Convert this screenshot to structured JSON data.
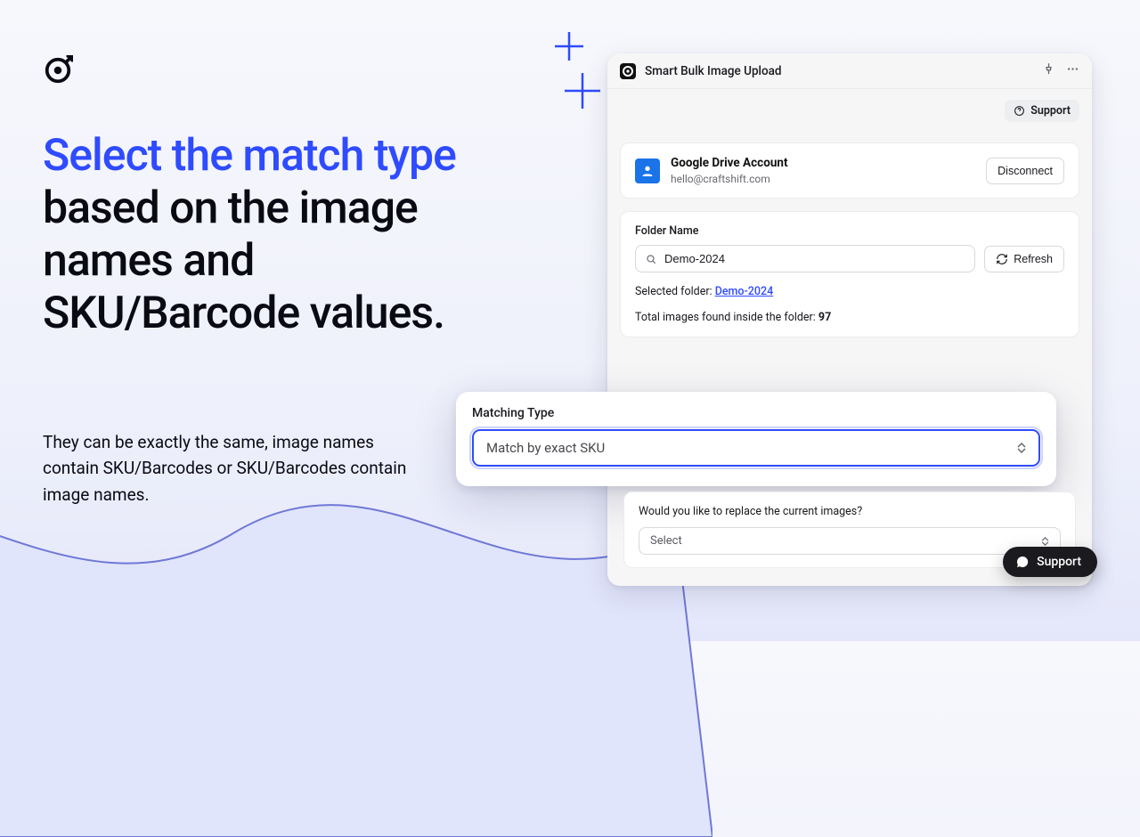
{
  "heading": {
    "accent_text": "Select the match type",
    "rest_text": " based on the image names and SKU/Barcode values."
  },
  "subheading": "They can be exactly the same, image names contain SKU/Barcodes or SKU/Barcodes contain image names.",
  "titlebar": {
    "title": "Smart Bulk Image Upload"
  },
  "support_pill": {
    "label": "Support"
  },
  "account": {
    "title": "Google Drive Account",
    "email": "hello@craftshift.com",
    "disconnect_label": "Disconnect"
  },
  "folder_section": {
    "label": "Folder Name",
    "input_value": "Demo-2024",
    "refresh_label": "Refresh",
    "selected_prefix": "Selected folder: ",
    "selected_link": "Demo-2024",
    "total_prefix": "Total images found inside the folder: ",
    "total_count": "97"
  },
  "match_callout": {
    "label": "Matching Type",
    "value": "Match by exact SKU"
  },
  "replace": {
    "question": "Would you like to replace the current images?",
    "placeholder": "Select"
  },
  "float_support": {
    "label": "Support"
  }
}
